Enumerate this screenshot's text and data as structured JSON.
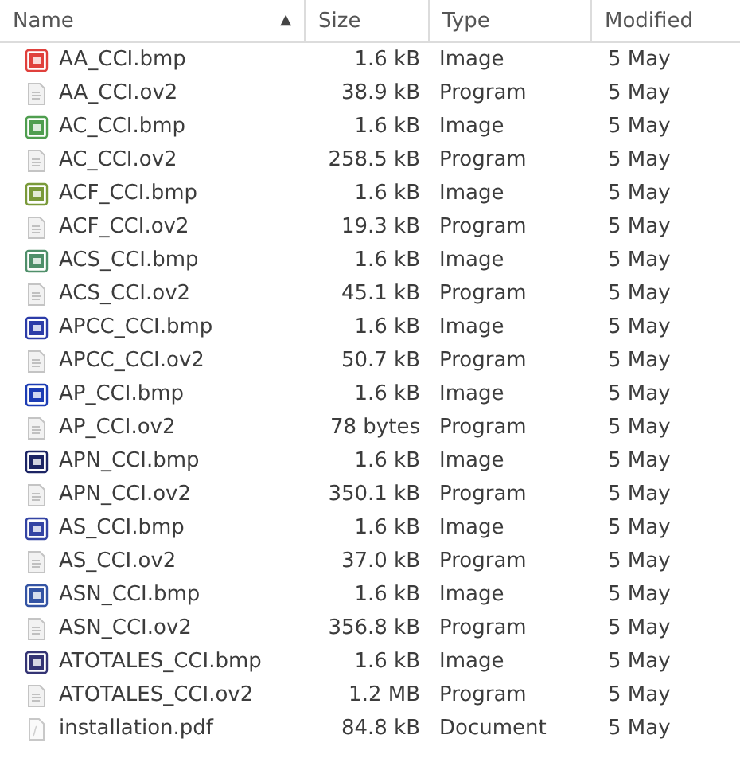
{
  "columns": [
    {
      "label": "Name",
      "sort": "▲"
    },
    {
      "label": "Size"
    },
    {
      "label": "Type"
    },
    {
      "label": "Modified"
    }
  ],
  "rows": [
    {
      "kind": "image",
      "color": "#e0403c",
      "name": "AA_CCI.bmp",
      "size": "1.6 kB",
      "type": "Image",
      "modified": "5 May"
    },
    {
      "kind": "program",
      "name": "AA_CCI.ov2",
      "size": "38.9 kB",
      "type": "Program",
      "modified": "5 May"
    },
    {
      "kind": "image",
      "color": "#4f9e4f",
      "name": "AC_CCI.bmp",
      "size": "1.6 kB",
      "type": "Image",
      "modified": "5 May"
    },
    {
      "kind": "program",
      "name": "AC_CCI.ov2",
      "size": "258.5 kB",
      "type": "Program",
      "modified": "5 May"
    },
    {
      "kind": "image",
      "color": "#7a9a3a",
      "name": "ACF_CCI.bmp",
      "size": "1.6 kB",
      "type": "Image",
      "modified": "5 May"
    },
    {
      "kind": "program",
      "name": "ACF_CCI.ov2",
      "size": "19.3 kB",
      "type": "Program",
      "modified": "5 May"
    },
    {
      "kind": "image",
      "color": "#4f8f6a",
      "name": "ACS_CCI.bmp",
      "size": "1.6 kB",
      "type": "Image",
      "modified": "5 May"
    },
    {
      "kind": "program",
      "name": "ACS_CCI.ov2",
      "size": "45.1 kB",
      "type": "Program",
      "modified": "5 May"
    },
    {
      "kind": "image",
      "color": "#2c3ca8",
      "name": "APCC_CCI.bmp",
      "size": "1.6 kB",
      "type": "Image",
      "modified": "5 May"
    },
    {
      "kind": "program",
      "name": "APCC_CCI.ov2",
      "size": "50.7 kB",
      "type": "Program",
      "modified": "5 May"
    },
    {
      "kind": "image",
      "color": "#1c3cb4",
      "name": "AP_CCI.bmp",
      "size": "1.6 kB",
      "type": "Image",
      "modified": "5 May"
    },
    {
      "kind": "program",
      "name": "AP_CCI.ov2",
      "size": "78 bytes",
      "type": "Program",
      "modified": "5 May"
    },
    {
      "kind": "image",
      "color": "#1c2464",
      "name": "APN_CCI.bmp",
      "size": "1.6 kB",
      "type": "Image",
      "modified": "5 May"
    },
    {
      "kind": "program",
      "name": "APN_CCI.ov2",
      "size": "350.1 kB",
      "type": "Program",
      "modified": "5 May"
    },
    {
      "kind": "image",
      "color": "#3444a4",
      "name": "AS_CCI.bmp",
      "size": "1.6 kB",
      "type": "Image",
      "modified": "5 May"
    },
    {
      "kind": "program",
      "name": "AS_CCI.ov2",
      "size": "37.0 kB",
      "type": "Program",
      "modified": "5 May"
    },
    {
      "kind": "image",
      "color": "#3454a4",
      "name": "ASN_CCI.bmp",
      "size": "1.6 kB",
      "type": "Image",
      "modified": "5 May"
    },
    {
      "kind": "program",
      "name": "ASN_CCI.ov2",
      "size": "356.8 kB",
      "type": "Program",
      "modified": "5 May"
    },
    {
      "kind": "image",
      "color": "#343474",
      "name": "ATOTALES_CCI.bmp",
      "size": "1.6 kB",
      "type": "Image",
      "modified": "5 May"
    },
    {
      "kind": "program",
      "name": "ATOTALES_CCI.ov2",
      "size": "1.2 MB",
      "type": "Program",
      "modified": "5 May"
    },
    {
      "kind": "document",
      "name": "installation.pdf",
      "size": "84.8 kB",
      "type": "Document",
      "modified": "5 May"
    }
  ]
}
